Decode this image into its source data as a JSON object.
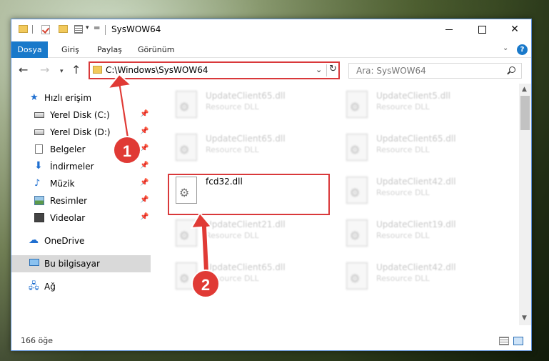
{
  "window": {
    "title": "SysWOW64"
  },
  "ribbon": {
    "tabs": [
      {
        "label": "Dosya"
      },
      {
        "label": "Giriş"
      },
      {
        "label": "Paylaş"
      },
      {
        "label": "Görünüm"
      }
    ],
    "help_label": "?"
  },
  "address_bar": {
    "path": "C:\\Windows\\SysWOW64"
  },
  "search": {
    "placeholder": "Ara: SysWOW64"
  },
  "sidebar": {
    "items": [
      {
        "label": "Hızlı erişim",
        "icon": "star-icon"
      },
      {
        "label": "Yerel Disk (C:)",
        "icon": "disk-icon",
        "pinned": true
      },
      {
        "label": "Yerel Disk (D:)",
        "icon": "disk-icon",
        "pinned": true
      },
      {
        "label": "Belgeler",
        "icon": "documents-icon",
        "pinned": true
      },
      {
        "label": "İndirmeler",
        "icon": "download-icon",
        "pinned": true
      },
      {
        "label": "Müzik",
        "icon": "music-icon",
        "pinned": true
      },
      {
        "label": "Resimler",
        "icon": "pictures-icon",
        "pinned": true
      },
      {
        "label": "Videolar",
        "icon": "videos-icon",
        "pinned": true
      },
      {
        "label": "OneDrive",
        "icon": "cloud-icon"
      },
      {
        "label": "Bu bilgisayar",
        "icon": "computer-icon",
        "selected": true
      },
      {
        "label": "Ağ",
        "icon": "network-icon"
      }
    ]
  },
  "files": [
    {
      "name": "UpdateClient65.dll",
      "type": "Resource DLL"
    },
    {
      "name": "UpdateClient5.dll",
      "type": "Resource DLL"
    },
    {
      "name": "UpdateClient65.dll",
      "type": "Resource DLL"
    },
    {
      "name": "UpdateClient65.dll",
      "type": "Resource DLL"
    },
    {
      "name": "fcd32.dll",
      "type": ""
    },
    {
      "name": "UpdateClient42.dll",
      "type": "Resource DLL"
    },
    {
      "name": "UpdateClient21.dll",
      "type": "Resource DLL"
    },
    {
      "name": "UpdateClient19.dll",
      "type": "Resource DLL"
    },
    {
      "name": "UpdateClient65.dll",
      "type": "Resource DLL"
    },
    {
      "name": "UpdateClient42.dll",
      "type": "Resource DLL"
    }
  ],
  "status": {
    "item_count": "166 öğe"
  },
  "annotations": {
    "step1": "1",
    "step2": "2",
    "color": "#e03a35"
  }
}
